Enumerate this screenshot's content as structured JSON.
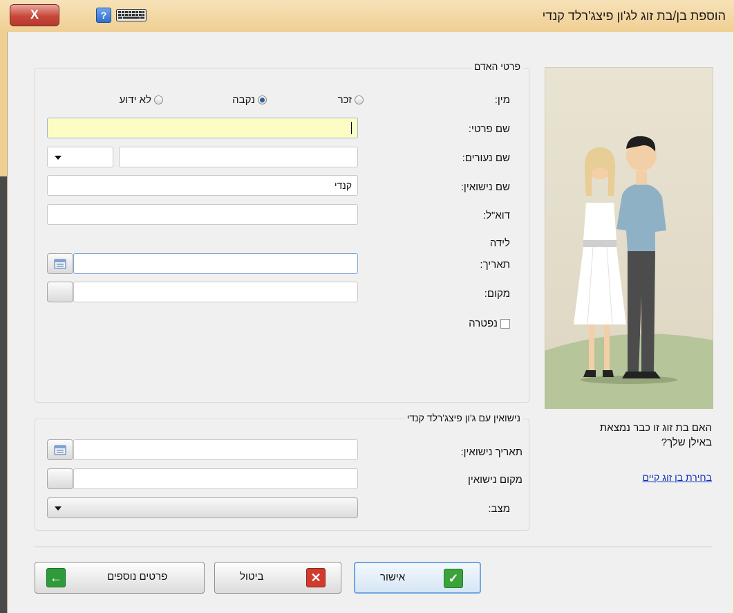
{
  "window": {
    "title": "הוספת בן/בת זוג לג'ון פיצג'רלד קנדי",
    "close_label": "X",
    "help_label": "?"
  },
  "person_group": {
    "title": "פרטי האדם",
    "gender_label": "מין:",
    "gender_options": [
      "זכר",
      "נקבה",
      "לא ידוע"
    ],
    "gender_selected": "נקבה",
    "first_name_label": "שם פרטי:",
    "first_name_value": "",
    "maiden_name_label": "שם נעורים:",
    "maiden_name_value": "",
    "married_name_label": "שם נישואין:",
    "married_name_value": "קנדי",
    "email_label": "דוא\"ל:",
    "email_value": "",
    "birth_heading": "לידה",
    "birth_date_label": "תאריך:",
    "birth_date_value": "",
    "birth_place_label": "מקום:",
    "birth_place_value": "",
    "deceased_label": "נפטרה",
    "deceased_checked": false
  },
  "marriage_group": {
    "title": "נישואין עם ג'ון פיצג'רלד קנדי",
    "date_label": "תאריך נישואין:",
    "date_value": "",
    "place_label": "מקום נישואין",
    "place_value": "",
    "status_label": "מצב:",
    "status_value": ""
  },
  "side_panel": {
    "question": "האם בת זוג זו כבר נמצאת באילן שלך?",
    "link": "בחירת בן זוג קיים"
  },
  "buttons": {
    "ok": "אישור",
    "cancel": "ביטול",
    "more": "פרטים נוספים"
  },
  "colors": {
    "title_bar": "#efcf93",
    "active_field": "#fdfcc4",
    "link": "#0a2dbd",
    "ok_icon": "#3aa43a",
    "cancel_icon": "#d23a2e",
    "more_icon": "#2f9a3a"
  }
}
